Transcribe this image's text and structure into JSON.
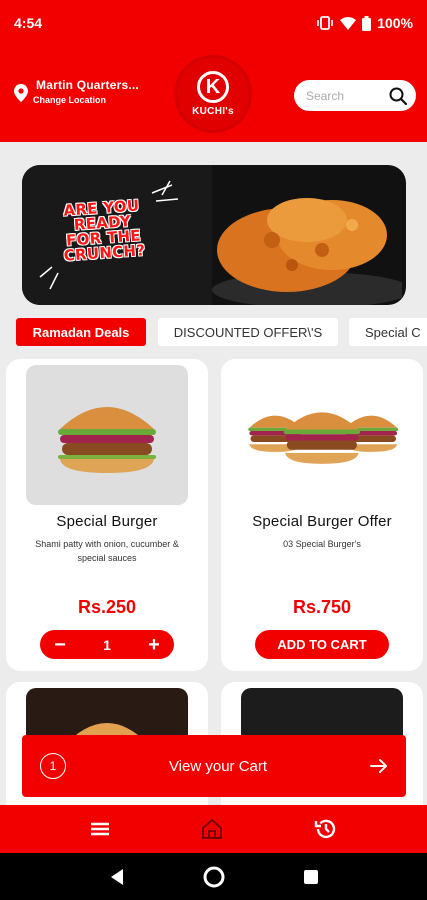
{
  "status": {
    "time": "4:54",
    "battery": "100%"
  },
  "header": {
    "location_title": "Martin Quarters...",
    "location_sub": "Change Location",
    "logo_letter": "K",
    "logo_text": "KUCHI's",
    "search_placeholder": "Search"
  },
  "banner": {
    "headline": "ARE YOU READY FOR THE CRUNCH?"
  },
  "tabs": [
    {
      "label": "Ramadan Deals",
      "active": true
    },
    {
      "label": "DISCOUNTED OFFER\\'S",
      "active": false
    },
    {
      "label": "Special C",
      "active": false
    }
  ],
  "products": [
    {
      "title": "Special Burger",
      "description": "Shami patty with onion, cucumber & special sauces",
      "price": "Rs.250",
      "quantity": "1",
      "decrement": "−",
      "increment": "+"
    },
    {
      "title": "Special Burger Offer",
      "description": "03 Special Burger's",
      "price": "Rs.750",
      "button": "ADD TO CART"
    }
  ],
  "cart": {
    "count": "1",
    "label": "View your Cart"
  },
  "colors": {
    "brand_red": "#f20000",
    "background": "#ececec"
  },
  "icons": {
    "statusbar": [
      "vibrate-icon",
      "wifi-icon",
      "battery-icon"
    ],
    "bottom_nav": [
      "menu-icon",
      "home-icon",
      "history-icon"
    ],
    "system_nav": [
      "back-icon",
      "home-circle-icon",
      "recents-icon"
    ]
  }
}
